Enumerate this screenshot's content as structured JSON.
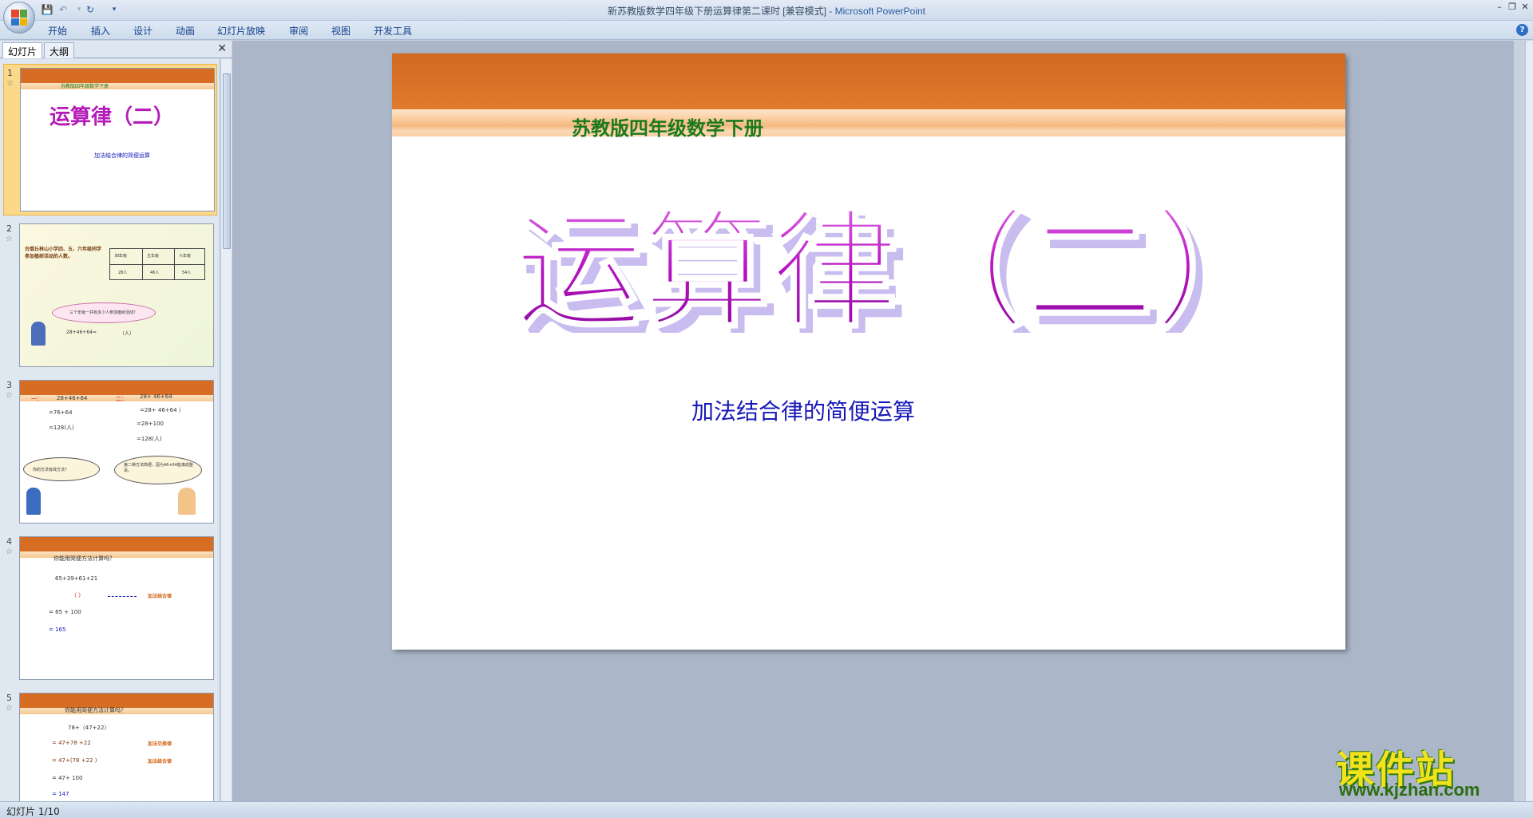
{
  "window": {
    "title": "新苏教版数学四年级下册运算律第二课时 [兼容模式] - ",
    "app_name": "Microsoft PowerPoint"
  },
  "ribbon": {
    "tabs": [
      "开始",
      "插入",
      "设计",
      "动画",
      "幻灯片放映",
      "审阅",
      "视图",
      "开发工具"
    ]
  },
  "pane": {
    "tabs": [
      "幻灯片",
      "大纲"
    ]
  },
  "thumbnails": [
    {
      "num": "1",
      "lines": [
        "苏教版四年级数学下册",
        "运算律（二）",
        "加法结合律的简便运算"
      ]
    },
    {
      "num": "2",
      "lines": [
        "台俄丘林山小学四、五、六年级同学参加植树活动的人数。",
        "四年级",
        "五年级",
        "六年级",
        "28人",
        "46人",
        "54人",
        "三个年级一共有多少人参加植树活动？",
        "28+46+64=",
        "（人）"
      ]
    },
    {
      "num": "3",
      "lines": [
        "一：",
        "28+46+64",
        "=76+64",
        "=128(人)",
        "二：",
        "28+ 46+64",
        "=28+ 46+64 ）",
        "=28+100",
        "=128(人)",
        "你的方法有效方法？",
        "第二种方法简便，因为46+64能凑成整百。"
      ]
    },
    {
      "num": "4",
      "lines": [
        "你能用简便方法计算吗？",
        "65+39+61+21",
        "（ ）",
        "加法结合律",
        "= 65 + 100",
        "= 165"
      ]
    },
    {
      "num": "5",
      "lines": [
        "你能用简便方法计算吗？",
        "78+（47+22）",
        "= 47+78 +22",
        "加法交换律",
        "= 47+(78 +22 )",
        "加法结合律",
        "= 47+ 100",
        "= 147"
      ]
    }
  ],
  "slide": {
    "header": "苏教版四年级数学下册",
    "title": "运算律（二）",
    "subtitle": "加法结合律的简便运算"
  },
  "watermark": {
    "title": "课件站",
    "url": "www.kjzhan.com"
  },
  "status": {
    "text": "幻灯片 1/10"
  }
}
